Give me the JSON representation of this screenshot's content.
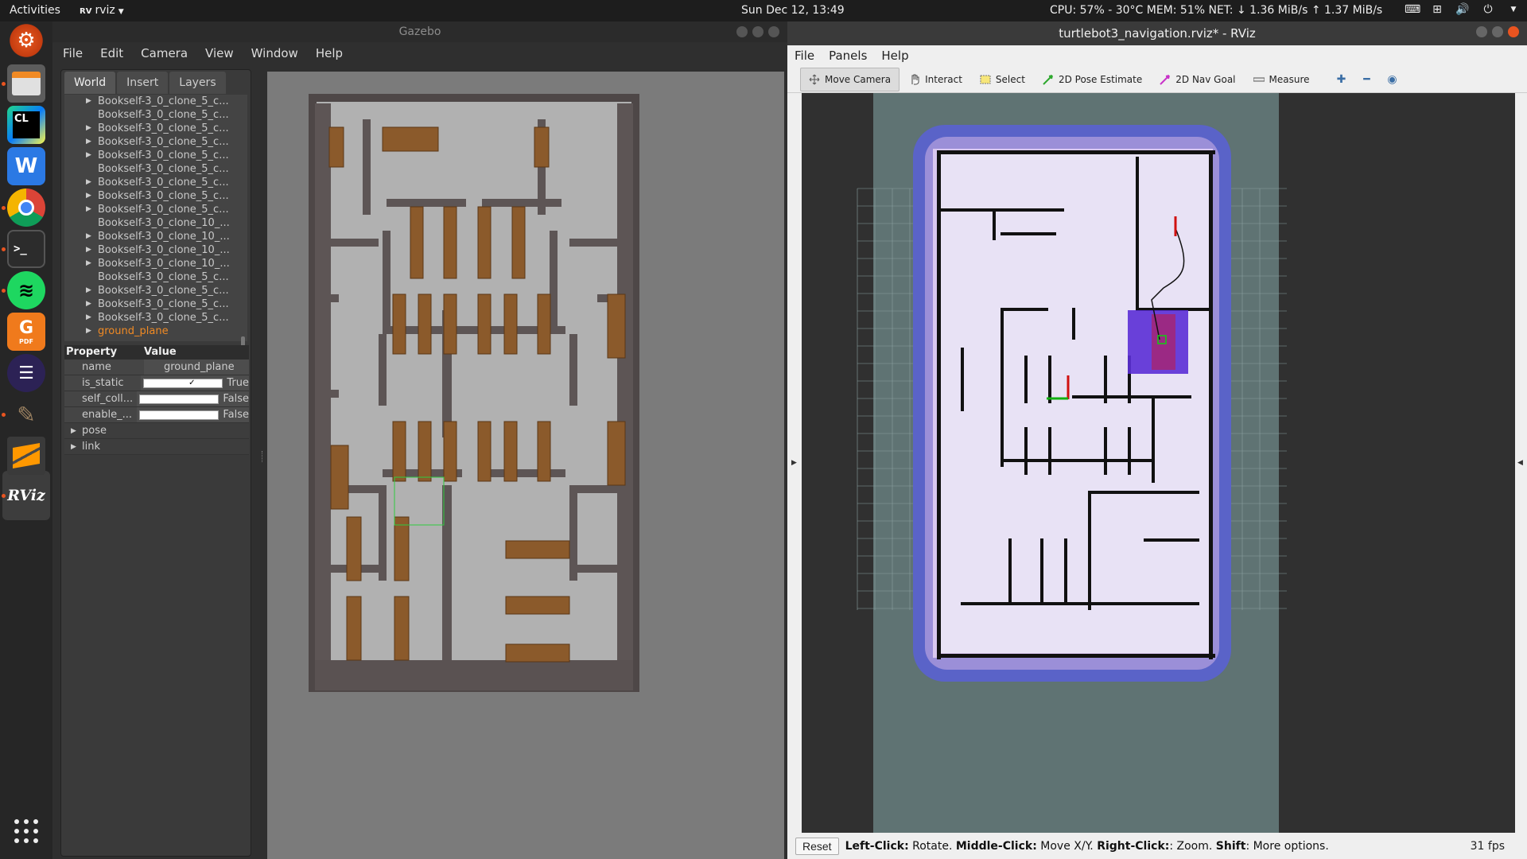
{
  "topbar": {
    "activities": "Activities",
    "app_name": "rviz",
    "app_badge": "RV",
    "clock": "Sun Dec 12, 13:49",
    "sysmon": "CPU: 57% - 30°C MEM: 51% NET: ↓  1.36 MiB/s ↑  1.37 MiB/s",
    "tray_icons": [
      "keyboard-icon",
      "network-icon",
      "volume-icon",
      "power-icon",
      "chevron-down-icon"
    ]
  },
  "dock": {
    "apps": [
      {
        "name": "software-updater-icon",
        "glyph": "⚙"
      },
      {
        "name": "files-icon",
        "glyph": "▭"
      },
      {
        "name": "clion-icon",
        "glyph": "CL"
      },
      {
        "name": "wps-writer-icon",
        "glyph": "W"
      },
      {
        "name": "chrome-icon",
        "glyph": "◉"
      },
      {
        "name": "terminal-icon",
        "glyph": ">_"
      },
      {
        "name": "spotify-icon",
        "glyph": "≋"
      },
      {
        "name": "pdf-editor-icon",
        "glyph": "G"
      },
      {
        "name": "eclipse-icon",
        "glyph": "☰"
      },
      {
        "name": "gimp-icon",
        "glyph": "✎"
      },
      {
        "name": "sublime-icon",
        "glyph": "S"
      },
      {
        "name": "rviz-icon",
        "glyph": "RViz"
      }
    ]
  },
  "gazebo": {
    "title": "Gazebo",
    "menu": [
      "File",
      "Edit",
      "Camera",
      "View",
      "Window",
      "Help"
    ],
    "tabs": [
      "World",
      "Insert",
      "Layers"
    ],
    "tree": [
      {
        "label": "Bookself-3_0_clone_5_c...",
        "expandable": true
      },
      {
        "label": "Bookself-3_0_clone_5_c...",
        "expandable": false
      },
      {
        "label": "Bookself-3_0_clone_5_c...",
        "expandable": true
      },
      {
        "label": "Bookself-3_0_clone_5_c...",
        "expandable": true
      },
      {
        "label": "Bookself-3_0_clone_5_c...",
        "expandable": true
      },
      {
        "label": "Bookself-3_0_clone_5_c...",
        "expandable": false
      },
      {
        "label": "Bookself-3_0_clone_5_c...",
        "expandable": true
      },
      {
        "label": "Bookself-3_0_clone_5_c...",
        "expandable": true
      },
      {
        "label": "Bookself-3_0_clone_5_c...",
        "expandable": true
      },
      {
        "label": "Bookself-3_0_clone_10_...",
        "expandable": false
      },
      {
        "label": "Bookself-3_0_clone_10_...",
        "expandable": true
      },
      {
        "label": "Bookself-3_0_clone_10_...",
        "expandable": true
      },
      {
        "label": "Bookself-3_0_clone_10_...",
        "expandable": true
      },
      {
        "label": "Bookself-3_0_clone_5_c...",
        "expandable": false
      },
      {
        "label": "Bookself-3_0_clone_5_c...",
        "expandable": true
      },
      {
        "label": "Bookself-3_0_clone_5_c...",
        "expandable": true
      },
      {
        "label": "Bookself-3_0_clone_5_c...",
        "expandable": true
      },
      {
        "label": "ground_plane",
        "expandable": true,
        "selected": true
      }
    ],
    "properties": {
      "header_property": "Property",
      "header_value": "Value",
      "rows": [
        {
          "key": "name",
          "value": "ground_plane",
          "checkbox": false
        },
        {
          "key": "is_static",
          "value": "True",
          "checkbox": true,
          "checked": true
        },
        {
          "key": "self_coll...",
          "value": "False",
          "checkbox": true,
          "checked": false
        },
        {
          "key": "enable_...",
          "value": "False",
          "checkbox": true,
          "checked": false
        }
      ],
      "groups": [
        "pose",
        "link"
      ]
    },
    "selected_color": "#f08a24"
  },
  "rviz": {
    "title": "turtlebot3_navigation.rviz* - RViz",
    "menu": [
      "File",
      "Panels",
      "Help"
    ],
    "tools": [
      {
        "label": "Move Camera",
        "icon": "move-camera-icon",
        "active": true
      },
      {
        "label": "Interact",
        "icon": "hand-icon",
        "active": false
      },
      {
        "label": "Select",
        "icon": "select-icon",
        "active": false
      },
      {
        "label": "2D Pose Estimate",
        "icon": "pose-estimate-icon",
        "active": false
      },
      {
        "label": "2D Nav Goal",
        "icon": "nav-goal-icon",
        "active": false
      },
      {
        "label": "Measure",
        "icon": "measure-icon",
        "active": false
      }
    ],
    "extra_tools": [
      "plus-icon",
      "minus-icon",
      "camera-eye-icon"
    ],
    "status": {
      "reset": "Reset",
      "hint_parts": [
        {
          "b": "Left-Click:",
          "t": " Rotate. "
        },
        {
          "b": "Middle-Click:",
          "t": " Move X/Y. "
        },
        {
          "b": "Right-Click:",
          "t": ": Zoom. "
        },
        {
          "b": "Shift",
          "t": ": More options."
        }
      ],
      "fps": "31 fps"
    },
    "colors": {
      "costmap_outer": "#5a63c8",
      "costmap_inner": "#d9c8f0",
      "free_space": "#e8e2f5",
      "unknown": "#5f7373",
      "background": "#303030"
    }
  }
}
